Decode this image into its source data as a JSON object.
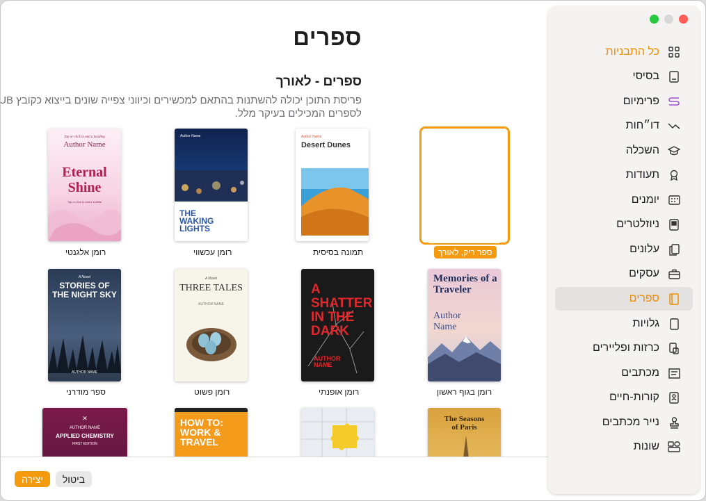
{
  "window": {
    "title": "ספרים",
    "section_title": "ספרים - לאורך",
    "section_desc": "פריסת התוכן יכולה להשתנות בהתאם למכשירים וכיווני צפייה שונים בייצוא כקובץ EPUB. מותאם במיוחד לספרים המכילים בעיקר מלל."
  },
  "sidebar": {
    "items": [
      {
        "label": "כל התבניות",
        "icon": "grid-icon"
      },
      {
        "label": "בסיסי",
        "icon": "document-icon"
      },
      {
        "label": "פרימיום",
        "icon": "premium-icon"
      },
      {
        "label": "דו״חות",
        "icon": "chart-line-icon"
      },
      {
        "label": "השכלה",
        "icon": "graduation-cap-icon"
      },
      {
        "label": "תעודות",
        "icon": "ribbon-icon"
      },
      {
        "label": "יומנים",
        "icon": "calendar-icon"
      },
      {
        "label": "ניוזלטרים",
        "icon": "newsletter-icon"
      },
      {
        "label": "עלונים",
        "icon": "brochure-icon"
      },
      {
        "label": "עסקים",
        "icon": "briefcase-icon"
      },
      {
        "label": "ספרים",
        "icon": "book-icon"
      },
      {
        "label": "גלויות",
        "icon": "postcard-icon"
      },
      {
        "label": "כרזות ופליירים",
        "icon": "poster-icon"
      },
      {
        "label": "מכתבים",
        "icon": "letter-icon"
      },
      {
        "label": "קורות-חיים",
        "icon": "resume-icon"
      },
      {
        "label": "נייר מכתבים",
        "icon": "stamp-icon"
      },
      {
        "label": "שונות",
        "icon": "shapes-icon"
      }
    ],
    "selected": "ספרים",
    "accent": "#f08c00"
  },
  "templates": {
    "row1": [
      {
        "caption": "ספר ריק, לאורך",
        "selected": true
      },
      {
        "caption": "תמונה בסיסית",
        "cover_title": "Desert Dunes",
        "cover_small": "Author Name"
      },
      {
        "caption": "רומן עכשווי",
        "cover_title": "THE WAKING LIGHTS",
        "cover_small": "Author Name"
      },
      {
        "caption": "רומן אלגנטי",
        "cover_title": "Eternal Shine",
        "cover_small": "Author Name",
        "cover_top": "Tap or click to add a heading",
        "cover_sub": "Tap or click to add a subtitle"
      }
    ],
    "row2": [
      {
        "caption": "רומן בגוף ראשון",
        "cover_title": "Memories of a Traveler",
        "cover_small": "Author Name"
      },
      {
        "caption": "רומן אופנתי",
        "cover_title": "A SHATTER IN THE DARK",
        "cover_small": "AUTHOR NAME"
      },
      {
        "caption": "רומן פשוט",
        "cover_title": "THREE TALES",
        "cover_small": "AUTHOR NAME",
        "cover_top": "A Novel"
      },
      {
        "caption": "ספר מודרני",
        "cover_title": "STORIES OF THE NIGHT SKY",
        "cover_small": "AUTHOR NAME",
        "cover_top": "A Novel"
      }
    ],
    "row3": [
      {
        "cover_title": "The Seasons of Paris"
      },
      {
        "cover_title": ""
      },
      {
        "cover_title": "HOW TO: WORK & TRAVEL"
      },
      {
        "cover_title": "APPLIED CHEMISTRY",
        "cover_small": "AUTHOR NAME",
        "cover_sub": "FIRST EDITION"
      }
    ]
  },
  "footer": {
    "cancel": "ביטול",
    "create": "יצירה"
  }
}
